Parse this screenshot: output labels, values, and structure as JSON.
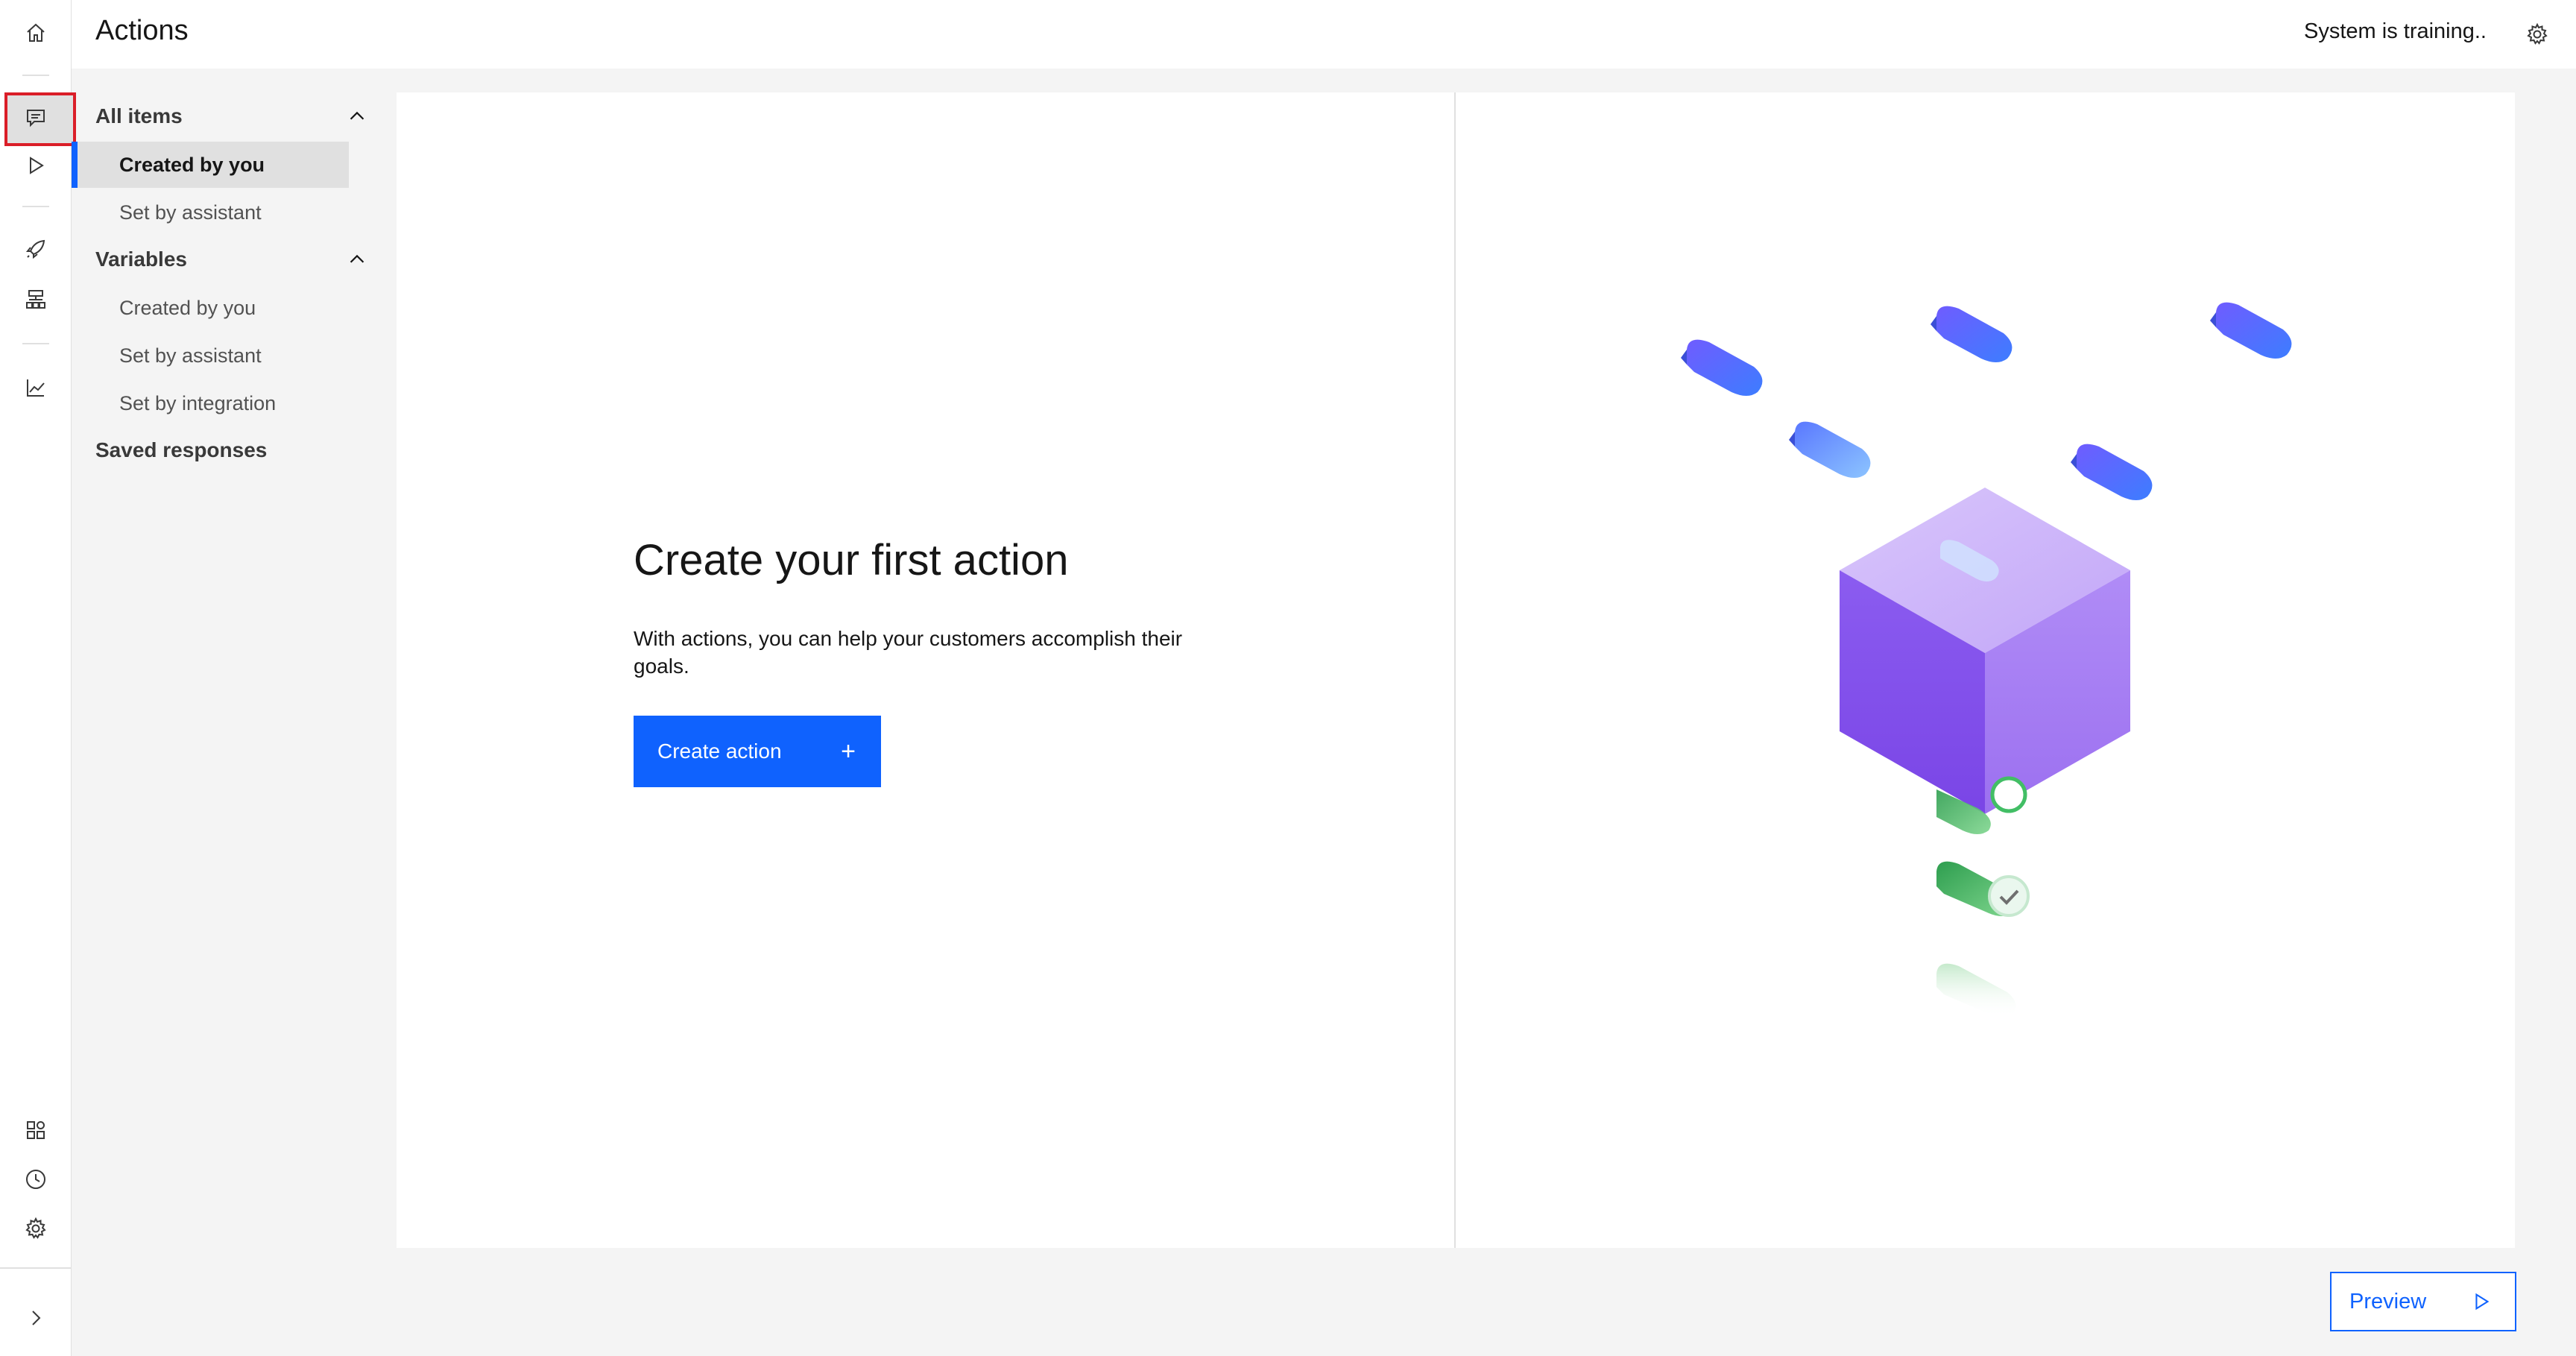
{
  "header": {
    "title": "Actions",
    "status": "System is training..",
    "settings_icon": "gear-icon"
  },
  "rail": {
    "items": [
      {
        "icon": "home-icon"
      },
      {
        "icon": "chat-icon",
        "active": true
      },
      {
        "icon": "play-icon"
      },
      {
        "icon": "rocket-icon"
      },
      {
        "icon": "hierarchy-icon"
      },
      {
        "icon": "chart-line-icon"
      },
      {
        "icon": "integrations-icon"
      },
      {
        "icon": "clock-icon"
      },
      {
        "icon": "gear-icon"
      },
      {
        "icon": "chevron-right-icon"
      }
    ],
    "active_highlight_color": "#da1e28"
  },
  "subnav": {
    "all_items": {
      "label": "All items",
      "children": [
        "Created by you",
        "Set by assistant"
      ],
      "selected": "Created by you"
    },
    "variables": {
      "label": "Variables",
      "children": [
        "Created by you",
        "Set by assistant",
        "Set by integration"
      ]
    },
    "saved_responses": "Saved responses"
  },
  "main": {
    "title": "Create your first action",
    "description": "With actions, you can help your customers accomplish their goals.",
    "create_button": "Create action",
    "create_button_icon": "+"
  },
  "preview_button": "Preview",
  "colors": {
    "primary": "#0f62fe",
    "background": "#f4f4f4",
    "surface": "#ffffff",
    "illustration_bubble": "#4a6cff",
    "illustration_box": "#9b6bf2",
    "illustration_check": "#42be65"
  }
}
